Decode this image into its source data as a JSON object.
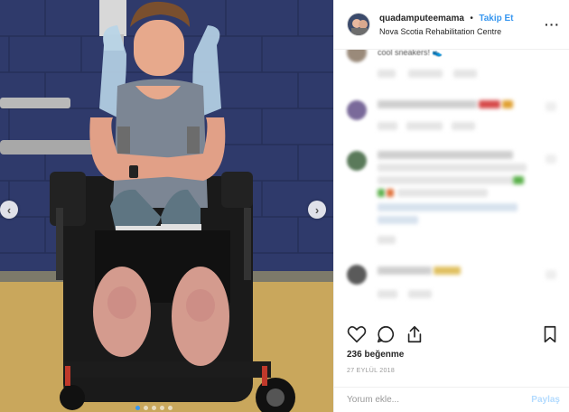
{
  "header": {
    "username": "quadamputeemama",
    "separator": "•",
    "follow_label": "Takip Et",
    "location": "Nova Scotia Rehabilitation Centre",
    "more_icon": "more-horizontal-icon"
  },
  "comments": {
    "visible_snippet": "cool sneakers! 👟"
  },
  "media": {
    "prev_icon": "chevron-left-icon",
    "next_icon": "chevron-right-icon",
    "prev_glyph": "‹",
    "next_glyph": "›"
  },
  "actions": {
    "like_icon": "heart-icon",
    "comment_icon": "comment-icon",
    "share_icon": "share-icon",
    "save_icon": "bookmark-icon"
  },
  "likes": "236 beğenme",
  "date": "27 EYLÜL 2018",
  "comment_box": {
    "placeholder": "Yorum ekle...",
    "post_label": "Paylaş"
  },
  "colors": {
    "accent": "#3897f0",
    "post_disabled": "#b3dbff"
  }
}
